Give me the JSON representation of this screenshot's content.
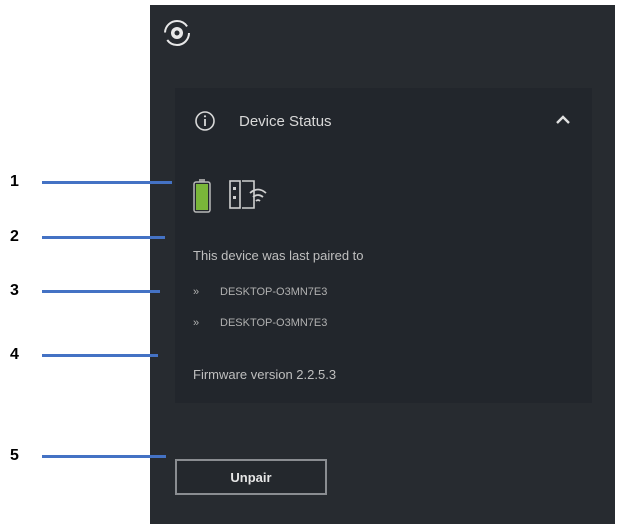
{
  "header": {
    "title": "Device Status"
  },
  "status": {
    "battery_color": "#7ab63a"
  },
  "paired": {
    "label": "This device was last paired to",
    "devices": [
      {
        "icon": "»",
        "name": "DESKTOP-O3MN7E3"
      },
      {
        "icon": "»",
        "name": "DESKTOP-O3MN7E3"
      }
    ]
  },
  "firmware": "Firmware version 2.2.5.3",
  "unpair_label": "Unpair",
  "callouts": [
    "1",
    "2",
    "3",
    "4",
    "5"
  ],
  "accent": "#4472c4"
}
